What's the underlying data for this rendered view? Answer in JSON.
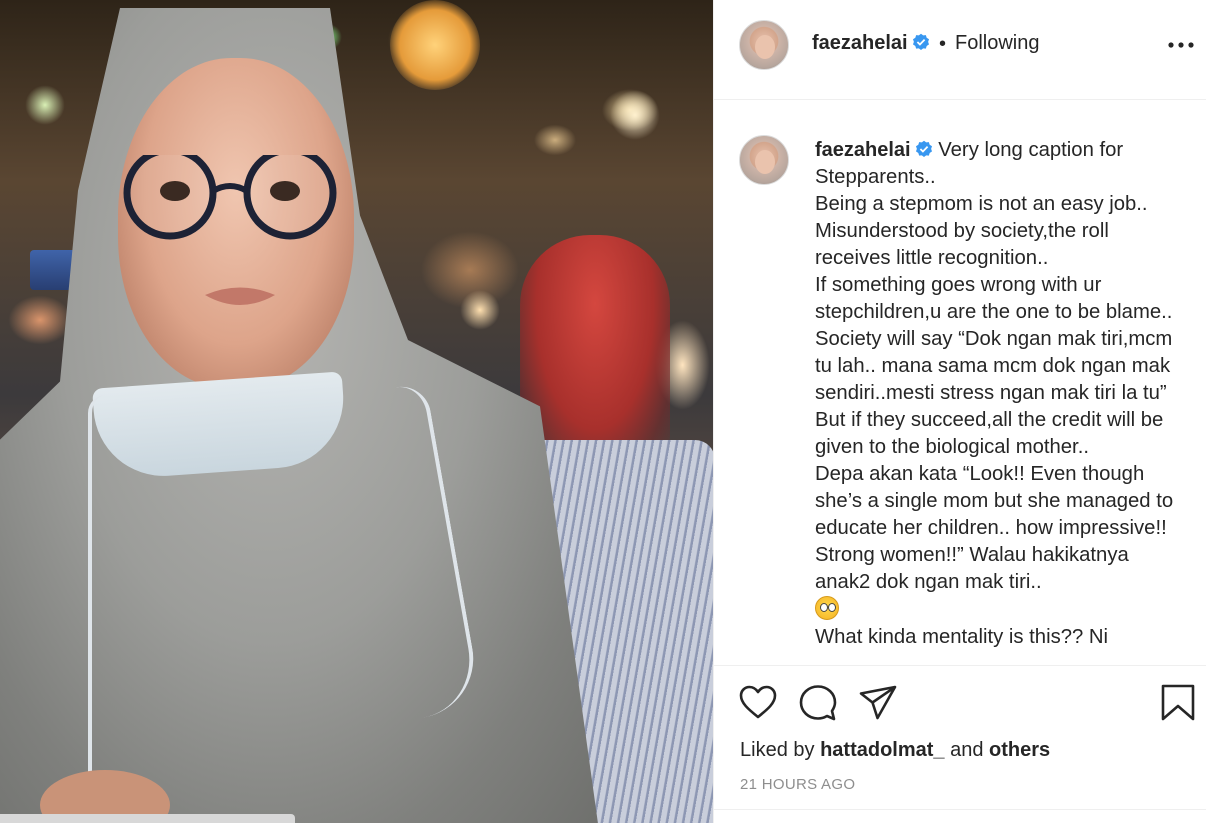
{
  "post": {
    "username": "faezahelai",
    "verified": true,
    "follow_status": "Following",
    "separator": "•",
    "more_icon": "more-options-icon",
    "photo_description_icon": "post-photo"
  },
  "caption": {
    "username": "faezahelai",
    "text_before_emoji": "Very long caption for Stepparents..\nBeing a stepmom is not an easy job.. Misunderstood by society,the roll receives little recognition..\nIf something goes wrong with ur stepchildren,u are the one to be blame.. Society will say “Dok ngan mak tiri,mcm tu lah.. mana sama mcm dok ngan mak sendiri..mesti stress ngan mak tiri la tu”\nBut if they succeed,all the credit will be given to the biological mother..\nDepa akan kata “Look!! Even though she’s a single mom but she managed to educate her children.. how impressive!! Strong women!!” Walau hakikatnya anak2 dok ngan mak tiri..\n",
    "text_after_emoji": "\nWhat kinda mentality is this?? Ni"
  },
  "actions": {
    "like_icon": "heart-icon",
    "comment_icon": "comment-icon",
    "share_icon": "share-icon",
    "save_icon": "bookmark-icon"
  },
  "likes": {
    "prefix": "Liked by",
    "user": "hattadolmat_",
    "conjunction": "and",
    "others": "others"
  },
  "timestamp": "21 HOURS AGO",
  "colors": {
    "verified_blue": "#3897f0",
    "text": "#262626",
    "muted": "#8e8e8e",
    "divider": "#efefef"
  }
}
